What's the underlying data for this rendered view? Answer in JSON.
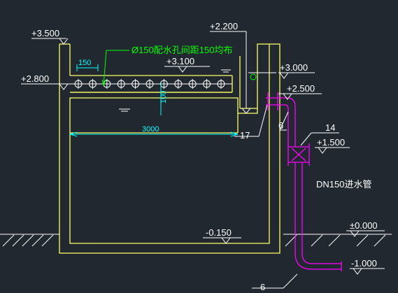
{
  "colors": {
    "background": "#212830",
    "tank": "#ffff66",
    "pipe": "#ff00ff",
    "dimension": "#00ffff",
    "note": "#00ff00",
    "text": "#ffffff",
    "leader": "#ffffff"
  },
  "elevations": {
    "tank_top": "+3.500",
    "weir_top": "+2.200",
    "water_level": "+3.100",
    "distribution_level": "+2.800",
    "outlet_top": "+3.000",
    "outlet_pipe": "+2.500",
    "valve": "+1.500",
    "tank_bottom": "-0.150",
    "ground": "±0.000",
    "inlet_pipe": "-1.000"
  },
  "dimensions": {
    "hole_spacing": "150",
    "channel_depth": "100",
    "tank_width": "3000"
  },
  "notes": {
    "distribution_holes": "Ø150配水孔间距150均布",
    "inlet_pipe": "DN150进水管"
  },
  "callouts": {
    "c17": "17",
    "c6_upper": "6",
    "c14": "14",
    "c6_lower": "6"
  }
}
